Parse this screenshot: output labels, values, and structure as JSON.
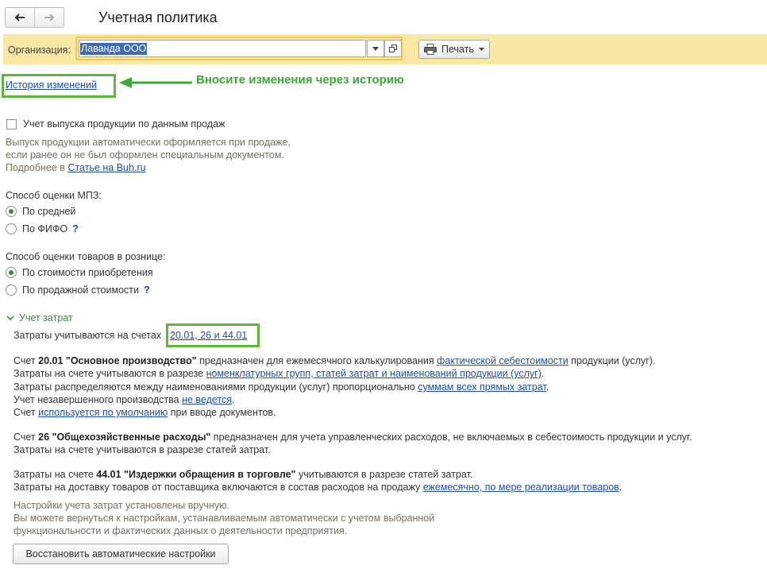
{
  "page_title": "Учетная политика",
  "org": {
    "label": "Организация:",
    "value": "Лаванда ООО"
  },
  "print_label": "Печать",
  "history_link": "История изменений",
  "annotation": "Вносите изменения через историю",
  "sales_checkbox": {
    "label": "Учет выпуска продукции по данным продаж",
    "checked": false,
    "desc1": "Выпуск продукции автоматически оформляется при продаже,",
    "desc2": "если ранее он не был оформлен специальным документом.",
    "more_prefix": "Подробнее в",
    "more_link": "Статье на Buh.ru"
  },
  "mpz": {
    "label": "Способ оценки МПЗ:",
    "options": [
      "По средней",
      "По ФИФО"
    ],
    "selected": 0
  },
  "retail": {
    "label": "Способ оценки товаров в рознице:",
    "options": [
      "По стоимости приобретения",
      "По продажной стоимости"
    ],
    "selected": 0
  },
  "help_mark": "?",
  "costs": {
    "header": "Учет затрат",
    "accounts_prefix": "Затраты учитываются на счетах",
    "accounts_link": "20.01, 26 и 44.01",
    "s20": {
      "l1_a": "Счет",
      "l1_bold": "20.01 \"Основное производство\"",
      "l1_b": "предназначен для ежемесячного калькулирования",
      "l1_link": "фактической себестоимости",
      "l1_c": "продукции (услуг).",
      "l2_a": "Затраты на счете учитываются в разрезе",
      "l2_link": "номенклатурных групп, статей затрат и наименований продукции (услуг)",
      "l2_b": ".",
      "l3_a": "Затраты распределяются между наименованиями продукции (услуг) пропорционально",
      "l3_link": "суммам всех прямых затрат",
      "l3_b": ".",
      "l4_a": "Учет незавершенного производства",
      "l4_link": "не ведется",
      "l4_b": ".",
      "l5_a": "Счет",
      "l5_link": "используется по умолчанию",
      "l5_b": "при вводе документов."
    },
    "s26": {
      "l1_a": "Счет",
      "l1_bold": "26 \"Общехозяйственные расходы\"",
      "l1_b": "предназначен для учета управленческих расходов, не включаемых в себестоимость продукции и услуг.",
      "l2": "Затраты на счете учитываются в разрезе статей затрат."
    },
    "s44": {
      "l1_a": "Затраты на счете",
      "l1_bold": "44.01 \"Издержки обращения в торговле\"",
      "l1_b": "учитываются в разрезе статей затрат.",
      "l2_a": "Затраты на доставку товаров от поставщика включаются в состав расходов на продажу",
      "l2_link": "ежемесячно, по мере реализации товаров",
      "l2_b": "."
    },
    "note1": "Настройки учета затрат установлены вручную.",
    "note2": "Вы можете вернуться к настройкам, устанавливаемым автоматически с учетом выбранной",
    "note3": "функциональности и фактических данных о деятельности предприятия.",
    "restore_button": "Восстановить автоматические настройки"
  },
  "colors": {
    "accent_green": "#5db83a",
    "annotation_green": "#3aaa35",
    "link": "#1f4fa3",
    "org_bar": "#f9e8a4"
  }
}
